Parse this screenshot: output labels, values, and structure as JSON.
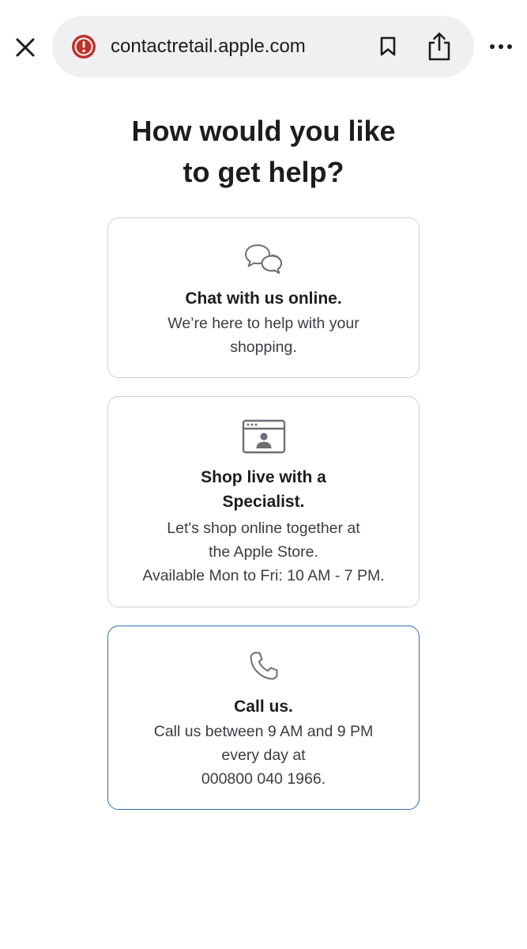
{
  "browser": {
    "url": "contactretail.apple.com",
    "icons": {
      "close": "close-icon",
      "security_warning": "warning-icon",
      "bookmark": "bookmark-icon",
      "share": "share-icon",
      "more": "more-icon"
    },
    "colors": {
      "urlbar_bg": "#f0f0f2",
      "warning_red": "#c0322b"
    }
  },
  "page": {
    "title_line1": "How would you like",
    "title_line2": "to get help?"
  },
  "options": [
    {
      "icon": "chat-bubbles-icon",
      "title_lines": [
        "Chat with us online."
      ],
      "desc_lines": [
        "We’re here to help with your",
        "shopping."
      ]
    },
    {
      "icon": "video-specialist-icon",
      "title_lines": [
        "Shop live with a",
        "Specialist."
      ],
      "desc_lines": [
        "Let's shop online together at",
        "the Apple Store.",
        "Available Mon to Fri: 10 AM - 7 PM."
      ]
    },
    {
      "icon": "phone-icon",
      "title_lines": [
        "Call us."
      ],
      "desc_lines": [
        "Call us between 9 AM and 9 PM",
        "every day at",
        "000800 040 1966."
      ]
    }
  ],
  "colors": {
    "card_border": "#d2d2d7",
    "selected_card_border": "#2f6fb5",
    "text_primary": "#1d1d1f",
    "text_secondary": "#3c3c43"
  }
}
